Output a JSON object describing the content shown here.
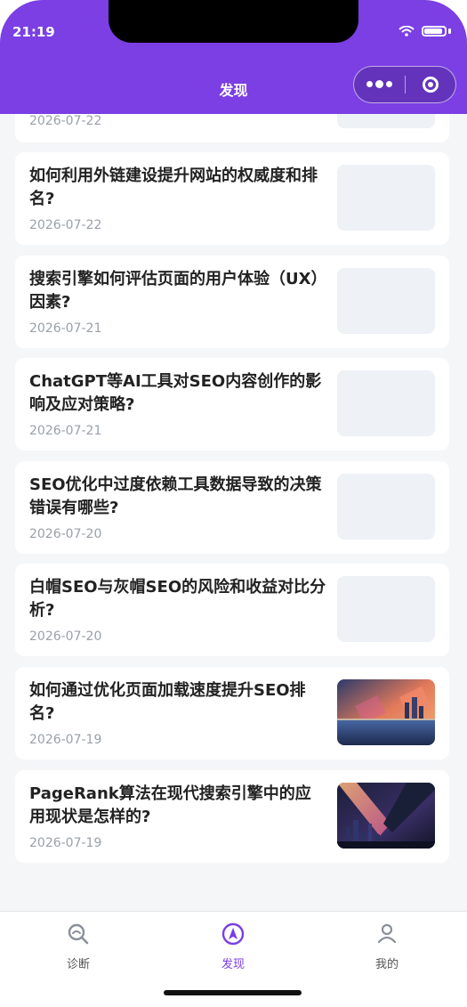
{
  "status_bar": {
    "time": "21:19"
  },
  "header": {
    "title": "发现"
  },
  "feed": {
    "partial_card": {
      "date": "2026-07-22"
    },
    "cards": [
      {
        "title": "如何利用外链建设提升网站的权威度和排名?",
        "date": "2026-07-22",
        "thumbnail": "placeholder"
      },
      {
        "title": "搜索引擎如何评估页面的用户体验（UX）因素?",
        "date": "2026-07-21",
        "thumbnail": "placeholder"
      },
      {
        "title": "ChatGPT等AI工具对SEO内容创作的影响及应对策略?",
        "date": "2026-07-21",
        "thumbnail": "placeholder"
      },
      {
        "title": "SEO优化中过度依赖工具数据导致的决策错误有哪些?",
        "date": "2026-07-20",
        "thumbnail": "placeholder"
      },
      {
        "title": "白帽SEO与灰帽SEO的风险和收益对比分析?",
        "date": "2026-07-20",
        "thumbnail": "placeholder"
      },
      {
        "title": "如何通过优化页面加载速度提升SEO排名?",
        "date": "2026-07-19",
        "thumbnail": "sunset-city-image"
      },
      {
        "title": "PageRank算法在现代搜索引擎中的应用现状是怎样的?",
        "date": "2026-07-19",
        "thumbnail": "night-city-image"
      }
    ]
  },
  "tabbar": {
    "tabs": [
      {
        "label": "诊断",
        "icon": "search-diagnose-icon"
      },
      {
        "label": "发现",
        "icon": "compass-icon",
        "active": true
      },
      {
        "label": "我的",
        "icon": "person-icon"
      }
    ]
  },
  "colors": {
    "accent": "#7b3fe4",
    "background": "#f5f6f8",
    "card": "#ffffff",
    "date": "#9aa0aa"
  }
}
